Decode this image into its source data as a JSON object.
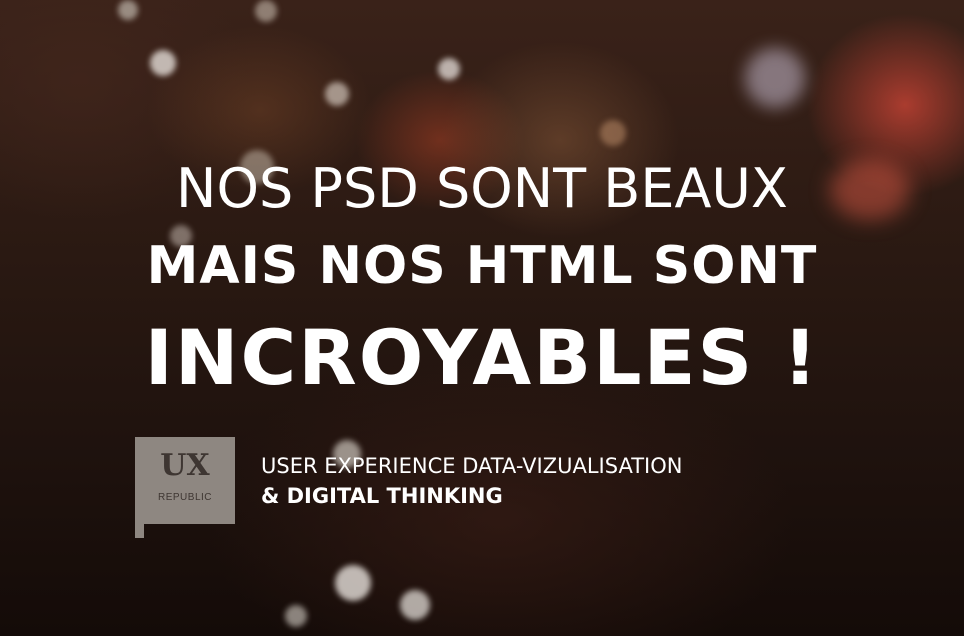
{
  "headline": {
    "line1": "NOS PSD SONT BEAUX",
    "line2": "MAIS NOS HTML SONT",
    "line3": "INCROYABLES !"
  },
  "logo": {
    "mark": "UX",
    "subtitle": "REPUBLIC"
  },
  "tagline": {
    "line1": "USER EXPERIENCE DATA-VIZUALISATION",
    "line2": "& DIGITAL THINKING"
  }
}
